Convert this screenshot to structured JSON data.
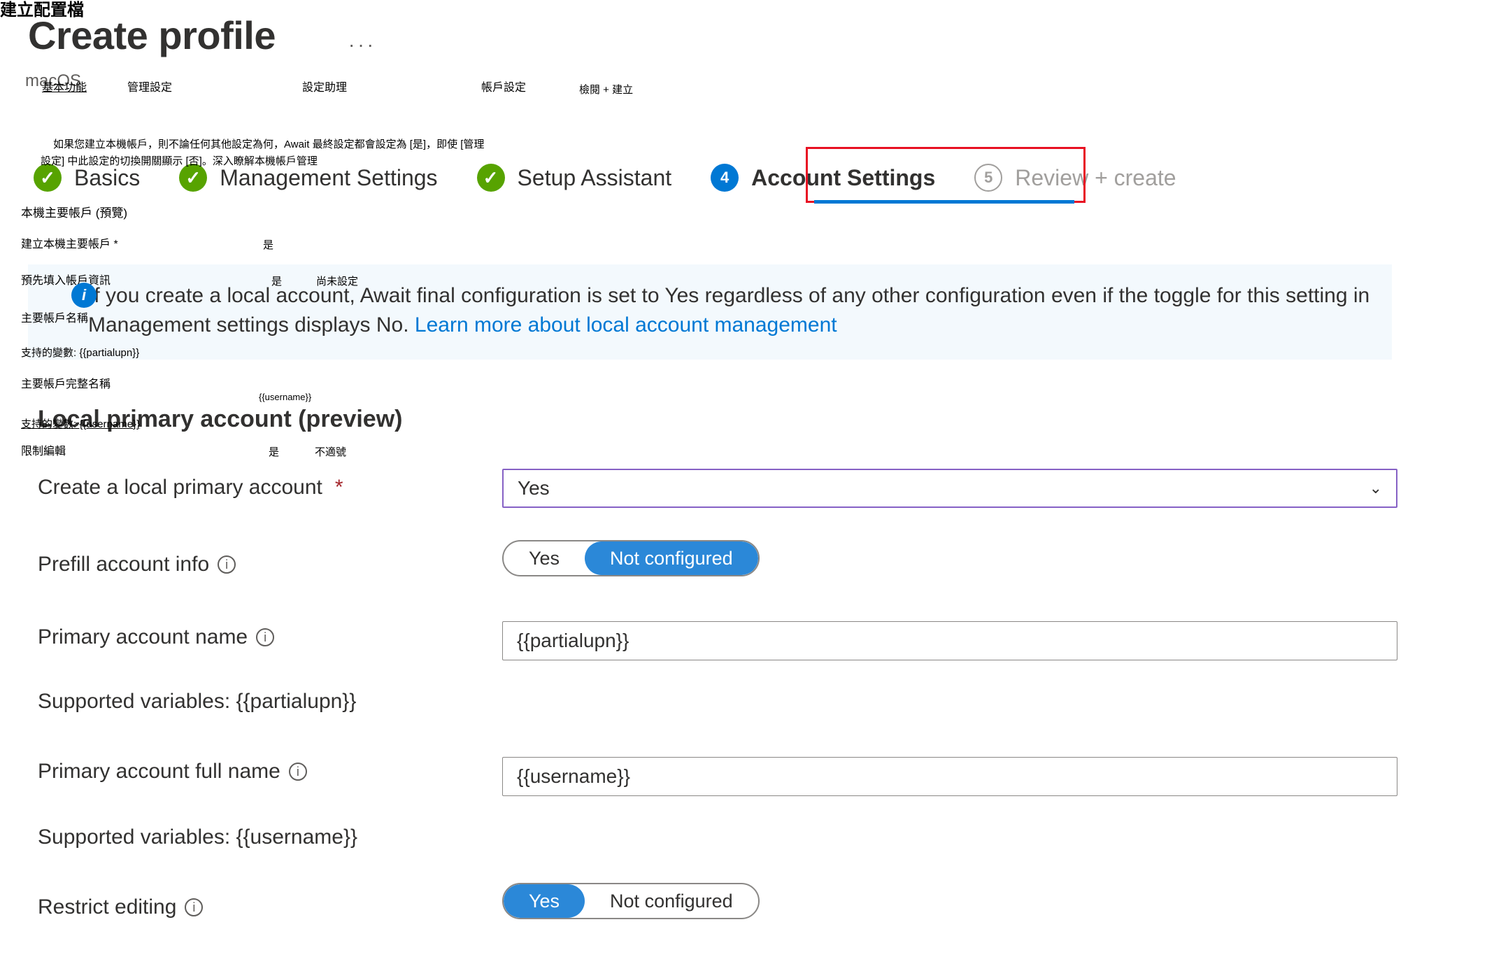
{
  "zh": {
    "title": "建立配置檔",
    "tabs": {
      "basics": "基本功能",
      "mgmt": "管理設定",
      "setup": "設定助理",
      "acct": "帳戶設定",
      "review": "檢閱 + 建立"
    },
    "info_l1": "如果您建立本機帳戶，則不論任何其他設定為何，Await 最終設定都會設定為 [是]，即使 [管理",
    "info_l2": "設定] 中此設定的切換開關顯示 [否]。深入瞭解本機帳戶管理",
    "section": "本機主要帳戶 (預覽)",
    "create_lbl": "建立本機主要帳戶 *",
    "create_val": "是",
    "prefill_lbl": "預先填入帳戶資訊",
    "prefill_yes": "是",
    "prefill_no": "尚未設定",
    "pname_lbl": "主要帳戶名稱",
    "hint_partial": "支持的變數: {{partialupn}}",
    "pfull_lbl": "主要帳戶完整名稱",
    "pfull_val": "{{username}}",
    "hint_user": "支持的變數: {{username}}",
    "restrict_lbl": "限制編輯",
    "restrict_yes": "是",
    "restrict_no": "不適號"
  },
  "title": "Create profile",
  "subtitle": "macOS",
  "steps": {
    "basics": "Basics",
    "mgmt": "Management Settings",
    "setup": "Setup Assistant",
    "acct_num": "4",
    "acct": "Account Settings",
    "review_num": "5",
    "review": "Review + create"
  },
  "info_text": "If you create a local account, Await final configuration is set to Yes regardless of any other configuration even if the toggle for this setting in Management settings displays No. ",
  "info_link": "Learn more about local account management",
  "section": "Local primary account (preview)",
  "fields": {
    "create": {
      "label": "Create a local primary account",
      "value": "Yes"
    },
    "prefill": {
      "label": "Prefill account info",
      "yes": "Yes",
      "no": "Not configured"
    },
    "pname": {
      "label": "Primary account name",
      "value": "{{partialupn}}"
    },
    "hint1": "Supported variables: {{partialupn}}",
    "pfull": {
      "label": "Primary account full name",
      "value": "{{username}}"
    },
    "hint2": "Supported variables: {{username}}",
    "restrict": {
      "label": "Restrict editing",
      "yes": "Yes",
      "no": "Not configured"
    }
  }
}
